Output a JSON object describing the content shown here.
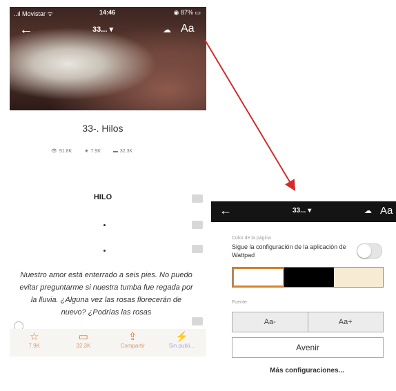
{
  "left": {
    "status": {
      "carrier": "..ıl Movistar ᯤ",
      "time": "14:46",
      "battery": "◉ 87% ▭"
    },
    "topbar": {
      "chapter": "33... ▾",
      "font_button": "Aa"
    },
    "chapter_title": "33-. Hilos",
    "stats": {
      "reads": "91.8K",
      "votes": "7.9K",
      "comments": "32.3K"
    },
    "heading": "HILO",
    "story_text": "Nuestro amor está enterrado a seis pies. No puedo evitar preguntarme si nuestra tumba fue regada por la lluvia. ¿Alguna vez las rosas florecerán de nuevo? ¿Podrías las rosas",
    "tabs": [
      {
        "label": "7.9K",
        "icon": "star-icon"
      },
      {
        "label": "32.3K",
        "icon": "comment-icon"
      },
      {
        "label": "Compartir",
        "icon": "share-icon"
      },
      {
        "label": "Sin publi...",
        "icon": "bolt-icon"
      }
    ]
  },
  "right": {
    "topbar": {
      "chapter": "33... ▾",
      "font_button": "Aa"
    },
    "page_color_label": "Color de la página",
    "sync_text": "Sigue la configuración de la aplicación de Wattpad",
    "font_label": "Fuente",
    "size_minus": "Aa-",
    "size_plus": "Aa+",
    "font_name": "Avenir",
    "more_settings": "Más configuraciones..."
  },
  "colors": {
    "accent": "#e07a2c",
    "arrow": "#d22b2b",
    "cream": "#f7ebd3"
  }
}
